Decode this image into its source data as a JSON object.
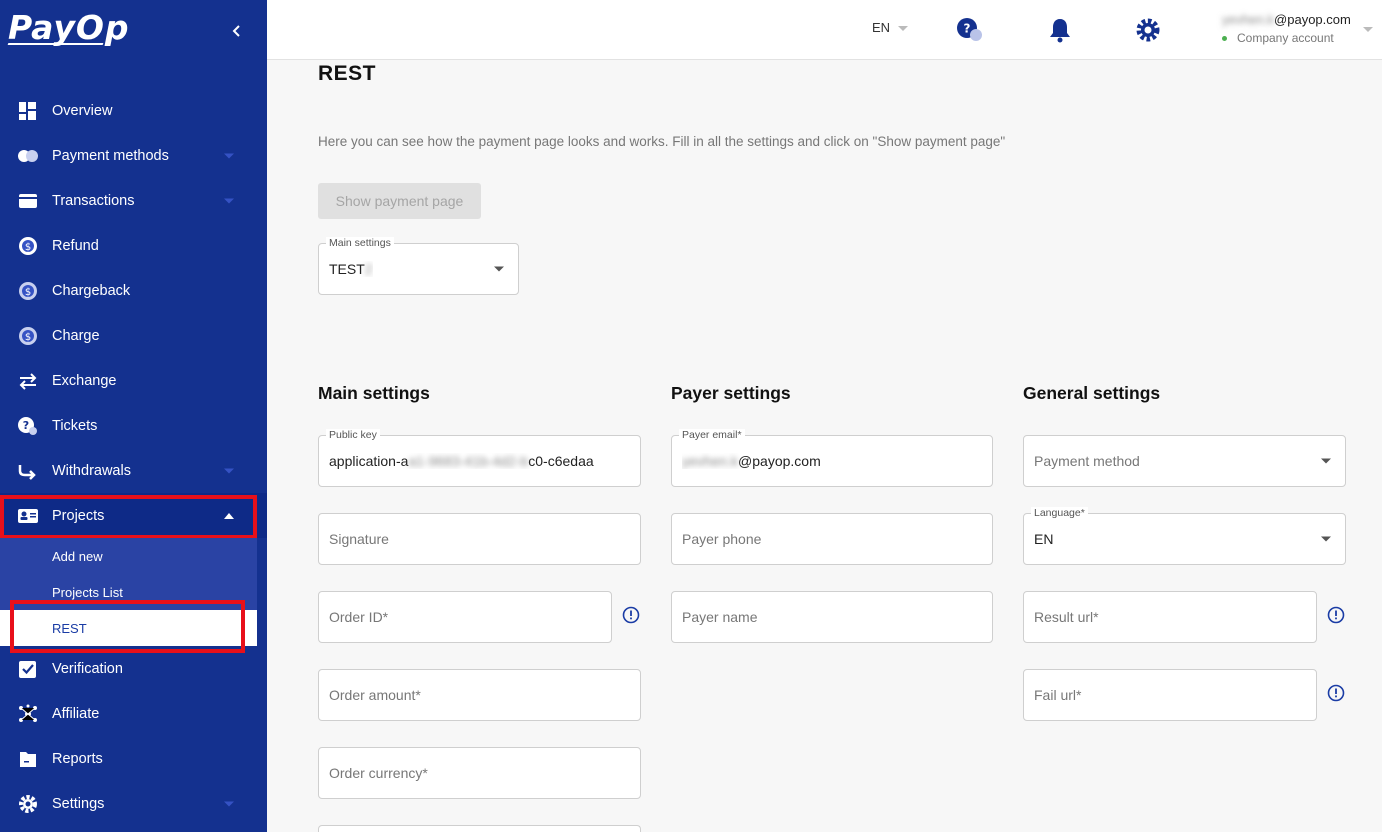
{
  "sidebar": {
    "logo": "PayOp",
    "items": [
      {
        "label": "Overview",
        "icon": "overview-icon"
      },
      {
        "label": "Payment methods",
        "icon": "payment-methods-icon"
      },
      {
        "label": "Transactions",
        "icon": "transactions-icon"
      },
      {
        "label": "Refund",
        "icon": "refund-icon"
      },
      {
        "label": "Chargeback",
        "icon": "chargeback-icon"
      },
      {
        "label": "Charge",
        "icon": "charge-icon"
      },
      {
        "label": "Exchange",
        "icon": "exchange-icon"
      },
      {
        "label": "Tickets",
        "icon": "tickets-icon"
      },
      {
        "label": "Withdrawals",
        "icon": "withdrawals-icon"
      },
      {
        "label": "Projects",
        "icon": "projects-icon"
      },
      {
        "label": "Verification",
        "icon": "verification-icon"
      },
      {
        "label": "Affiliate",
        "icon": "affiliate-icon"
      },
      {
        "label": "Reports",
        "icon": "reports-icon"
      },
      {
        "label": "Settings",
        "icon": "settings-icon"
      }
    ],
    "projects_submenu": [
      "Add new",
      "Projects List",
      "REST"
    ]
  },
  "topbar": {
    "language": "EN",
    "user_email_hidden": "yevhen.k",
    "user_email_domain": "@payop.com",
    "account_type": "Company account"
  },
  "main": {
    "title": "REST",
    "description": "Here you can see how the payment page looks and works. Fill in all the settings and click on \"Show payment page\"",
    "show_button": "Show payment page",
    "project_select": {
      "label": "Main settings",
      "value": "TEST",
      "value_hidden": "2"
    },
    "main_settings": {
      "title": "Main settings",
      "public_key": {
        "label": "Public key",
        "value_start": "application-a",
        "value_hidden": "a1-9683-41b-4d2-b",
        "value_end": "c0-c6edaa"
      },
      "signature": "Signature",
      "order_id": "Order ID*",
      "order_amount": "Order amount*",
      "order_currency": "Order currency*"
    },
    "payer_settings": {
      "title": "Payer settings",
      "payer_email": {
        "label": "Payer email*",
        "value_hidden": "yevhen.k",
        "value_end": "@payop.com"
      },
      "payer_phone": "Payer phone",
      "payer_name": "Payer name"
    },
    "general_settings": {
      "title": "General settings",
      "payment_method": "Payment method",
      "language": {
        "label": "Language*",
        "value": "EN"
      },
      "result_url": "Result url*",
      "fail_url": "Fail url*"
    }
  },
  "colors": {
    "sidebar_bg": "#14318f",
    "accent": "#1a3ca5",
    "highlight": "#e8101a"
  }
}
